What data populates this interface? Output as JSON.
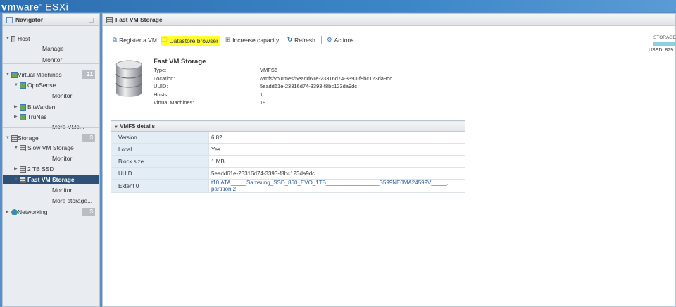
{
  "header": {
    "logo_prefix": "vm",
    "logo_suffix": "ware",
    "product": "ESXi"
  },
  "navigator": {
    "title": "Navigator",
    "items": [
      {
        "label": "Host"
      },
      {
        "label": "Manage"
      },
      {
        "label": "Monitor"
      },
      {
        "label": "Virtual Machines",
        "badge": "21"
      },
      {
        "label": "OpnSense"
      },
      {
        "label": "Monitor"
      },
      {
        "label": "BitWarden"
      },
      {
        "label": "TruNas"
      },
      {
        "label": "More VMs..."
      },
      {
        "label": "Storage",
        "badge": "3"
      },
      {
        "label": "Slow VM Storage"
      },
      {
        "label": "Monitor"
      },
      {
        "label": "2 TB SSD"
      },
      {
        "label": "Fast VM Storage",
        "selected": true
      },
      {
        "label": "Monitor"
      },
      {
        "label": "More storage..."
      },
      {
        "label": "Networking",
        "badge": "3"
      }
    ]
  },
  "main": {
    "title": "Fast VM Storage",
    "toolbar": {
      "register": "Register a VM",
      "browser": "Datastore browser",
      "increase": "Increase capacity",
      "refresh": "Refresh",
      "actions": "Actions"
    },
    "summary": {
      "name": "Fast VM Storage",
      "rows": [
        {
          "label": "Type:",
          "value": "VMFS6"
        },
        {
          "label": "Location:",
          "value": "/vmfs/volumes/5eadd61e-23316d74-3393-f8bc123da9dc"
        },
        {
          "label": "UUID:",
          "value": "5eadd61e-23316d74-3393-f8bc123da9dc"
        },
        {
          "label": "Hosts:",
          "value": "1"
        },
        {
          "label": "Virtual Machines:",
          "value": "19"
        }
      ]
    },
    "storage_meter": {
      "label": "STORAGE",
      "used": "USED: 829.",
      "fill_percent": 100,
      "color": "#8ecfe0"
    },
    "vmfs": {
      "title": "VMFS details",
      "rows": [
        {
          "label": "Version",
          "value": "6.82"
        },
        {
          "label": "Local",
          "value": "Yes"
        },
        {
          "label": "Block size",
          "value": "1 MB"
        },
        {
          "label": "UUID",
          "value": "5eadd61e-23316d74-3393-f8bc123da9dc"
        },
        {
          "label": "Extent 0",
          "value": "t10.ATA_____Samsung_SSD_860_EVO_1TB_________________S599NE0MA24599V_____, partition 2"
        }
      ]
    }
  }
}
